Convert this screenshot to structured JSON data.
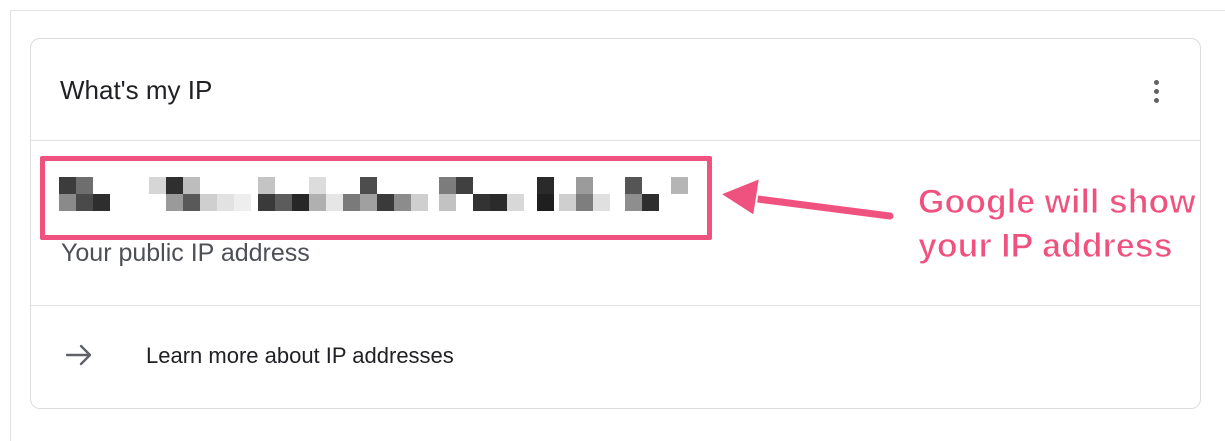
{
  "card": {
    "title": "What's my IP",
    "more_icon": "more-vert-icon"
  },
  "ip": {
    "value_state": "pixelated",
    "caption": "Your public IP address"
  },
  "learn_more": {
    "icon": "arrow-right-icon",
    "label": "Learn more about IP addresses"
  },
  "annotation": {
    "callout_text": "Google will show your IP address",
    "color": "#f0527f"
  },
  "colors": {
    "text_primary": "#202124",
    "text_secondary": "#4d5156",
    "divider": "#e3e3e3",
    "accent": "#f0527f"
  }
}
